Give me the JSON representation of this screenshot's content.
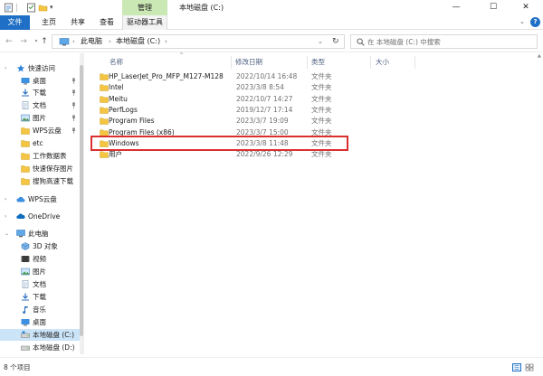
{
  "window": {
    "title": "本地磁盘 (C:)",
    "manage_tab": "管理"
  },
  "ribbon": {
    "tabs": [
      "文件",
      "主页",
      "共享",
      "查看",
      "驱动器工具"
    ]
  },
  "address": {
    "crumbs": [
      "此电脑",
      "本地磁盘 (C:)"
    ]
  },
  "search": {
    "placeholder": "在 本地磁盘 (C:) 中搜索"
  },
  "sidebar": {
    "items": [
      {
        "label": "快速访问",
        "icon": "star-icon"
      },
      {
        "label": "桌面",
        "icon": "desktop-icon",
        "pinned": true
      },
      {
        "label": "下载",
        "icon": "download-icon",
        "pinned": true
      },
      {
        "label": "文档",
        "icon": "document-icon",
        "pinned": true
      },
      {
        "label": "图片",
        "icon": "picture-icon",
        "pinned": true
      },
      {
        "label": "WPS云盘",
        "icon": "folder-icon",
        "pinned": true
      },
      {
        "label": "etc",
        "icon": "folder-icon"
      },
      {
        "label": "工作数据表",
        "icon": "folder-icon"
      },
      {
        "label": "快速保存图片",
        "icon": "folder-icon"
      },
      {
        "label": "搜狗高速下载",
        "icon": "folder-icon"
      },
      {
        "label": "WPS云盘",
        "icon": "wps-cloud-icon"
      },
      {
        "label": "OneDrive",
        "icon": "onedrive-icon"
      },
      {
        "label": "此电脑",
        "icon": "computer-icon"
      },
      {
        "label": "3D 对象",
        "icon": "cube-icon"
      },
      {
        "label": "视频",
        "icon": "video-icon"
      },
      {
        "label": "图片",
        "icon": "picture-icon"
      },
      {
        "label": "文档",
        "icon": "document-icon"
      },
      {
        "label": "下载",
        "icon": "download-icon"
      },
      {
        "label": "音乐",
        "icon": "music-icon"
      },
      {
        "label": "桌面",
        "icon": "desktop-icon"
      },
      {
        "label": "本地磁盘 (C:)",
        "icon": "drive-icon",
        "selected": true
      },
      {
        "label": "本地磁盘 (D:)",
        "icon": "drive-icon"
      }
    ]
  },
  "columns": [
    "名称",
    "修改日期",
    "类型",
    "大小"
  ],
  "files": [
    {
      "name": "HP_LaserJet_Pro_MFP_M127-M128",
      "date": "2022/10/14 16:48",
      "type": "文件夹"
    },
    {
      "name": "Intel",
      "date": "2023/3/8 8:54",
      "type": "文件夹"
    },
    {
      "name": "Meitu",
      "date": "2022/10/7 14:27",
      "type": "文件夹"
    },
    {
      "name": "PerfLogs",
      "date": "2019/12/7 17:14",
      "type": "文件夹"
    },
    {
      "name": "Program Files",
      "date": "2023/3/7 19:09",
      "type": "文件夹"
    },
    {
      "name": "Program Files (x86)",
      "date": "2023/3/7 15:00",
      "type": "文件夹"
    },
    {
      "name": "Windows",
      "date": "2023/3/8 11:48",
      "type": "文件夹"
    },
    {
      "name": "用户",
      "date": "2022/9/26 12:29",
      "type": "文件夹"
    }
  ],
  "status": {
    "count": "8 个项目"
  },
  "colors": {
    "accent": "#1e6fc5",
    "manage": "#c9e8b4",
    "selection": "#cce4f7",
    "folder": "#f4c542",
    "highlight": "#d9302f"
  }
}
